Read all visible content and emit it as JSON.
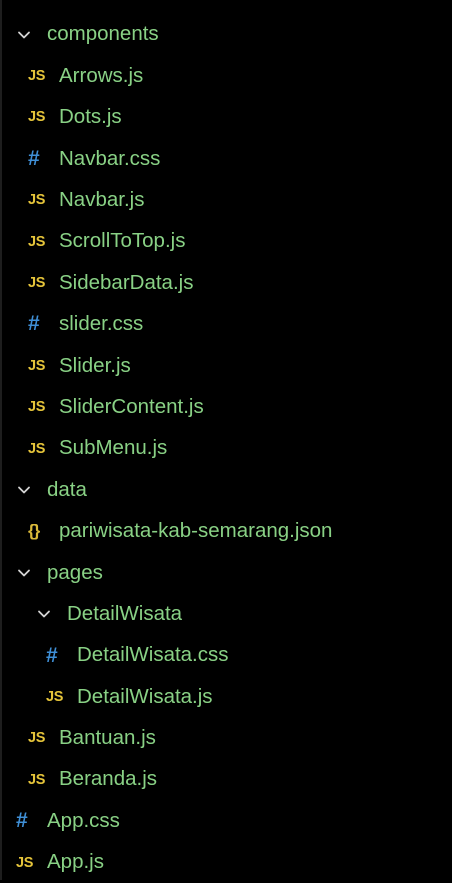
{
  "explorer": {
    "items": [
      {
        "type": "folder",
        "label": "components",
        "depth": 0,
        "icon": "chevron-down-icon"
      },
      {
        "type": "js",
        "label": "Arrows.js",
        "depth": 1,
        "badge": "JS"
      },
      {
        "type": "js",
        "label": "Dots.js",
        "depth": 1,
        "badge": "JS"
      },
      {
        "type": "css",
        "label": "Navbar.css",
        "depth": 1,
        "badge": "#"
      },
      {
        "type": "js",
        "label": "Navbar.js",
        "depth": 1,
        "badge": "JS"
      },
      {
        "type": "js",
        "label": "ScrollToTop.js",
        "depth": 1,
        "badge": "JS"
      },
      {
        "type": "js",
        "label": "SidebarData.js",
        "depth": 1,
        "badge": "JS"
      },
      {
        "type": "css",
        "label": "slider.css",
        "depth": 1,
        "badge": "#"
      },
      {
        "type": "js",
        "label": "Slider.js",
        "depth": 1,
        "badge": "JS"
      },
      {
        "type": "js",
        "label": "SliderContent.js",
        "depth": 1,
        "badge": "JS"
      },
      {
        "type": "js",
        "label": "SubMenu.js",
        "depth": 1,
        "badge": "JS"
      },
      {
        "type": "folder",
        "label": "data",
        "depth": 0,
        "icon": "chevron-down-icon"
      },
      {
        "type": "json",
        "label": "pariwisata-kab-semarang.json",
        "depth": 1,
        "badge": "{}"
      },
      {
        "type": "folder",
        "label": "pages",
        "depth": 0,
        "icon": "chevron-down-icon"
      },
      {
        "type": "folder",
        "label": "DetailWisata",
        "depth": 1,
        "icon": "chevron-down-icon"
      },
      {
        "type": "css",
        "label": "DetailWisata.css",
        "depth": 2,
        "badge": "#"
      },
      {
        "type": "js",
        "label": "DetailWisata.js",
        "depth": 2,
        "badge": "JS"
      },
      {
        "type": "js",
        "label": "Bantuan.js",
        "depth": 1,
        "badge": "JS"
      },
      {
        "type": "js",
        "label": "Beranda.js",
        "depth": 1,
        "badge": "JS"
      },
      {
        "type": "css",
        "label": "App.css",
        "depth": 0,
        "badge": "#"
      },
      {
        "type": "js",
        "label": "App.js",
        "depth": 0,
        "badge": "JS"
      }
    ]
  },
  "colors": {
    "filename": "#89d185",
    "js_badge": "#e5c43a",
    "css_badge": "#3f8fd6",
    "json_badge": "#d9b93a",
    "chevron": "#d4d4d4",
    "background": "#000000"
  }
}
